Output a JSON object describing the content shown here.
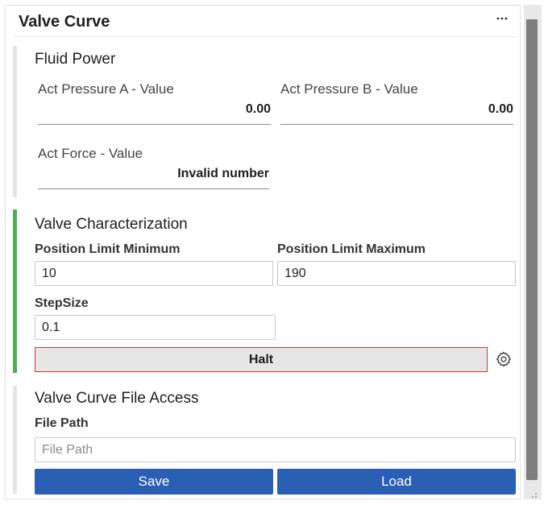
{
  "panel": {
    "title": "Valve Curve",
    "menu_icon": "more-horizontal-icon"
  },
  "fluid_power": {
    "title": "Fluid Power",
    "pressure_a": {
      "label": "Act Pressure A - Value",
      "value": "0.00"
    },
    "pressure_b": {
      "label": "Act Pressure B - Value",
      "value": "0.00"
    },
    "force": {
      "label": "Act Force - Value",
      "value": "Invalid number"
    }
  },
  "valve_characterization": {
    "title": "Valve Characterization",
    "position_min": {
      "label": "Position Limit Minimum",
      "value": "10"
    },
    "position_max": {
      "label": "Position Limit Maximum",
      "value": "190"
    },
    "step_size": {
      "label": "StepSize",
      "value": "0.1"
    },
    "halt_label": "Halt",
    "settings_icon": "gear-icon",
    "accent_color": "#4caf50",
    "halt_border_color": "#d13438"
  },
  "file_access": {
    "title": "Valve Curve File Access",
    "file_path": {
      "label": "File Path",
      "value": "",
      "placeholder": "File Path"
    },
    "save_label": "Save",
    "load_label": "Load",
    "button_color": "#2b5fb4"
  }
}
